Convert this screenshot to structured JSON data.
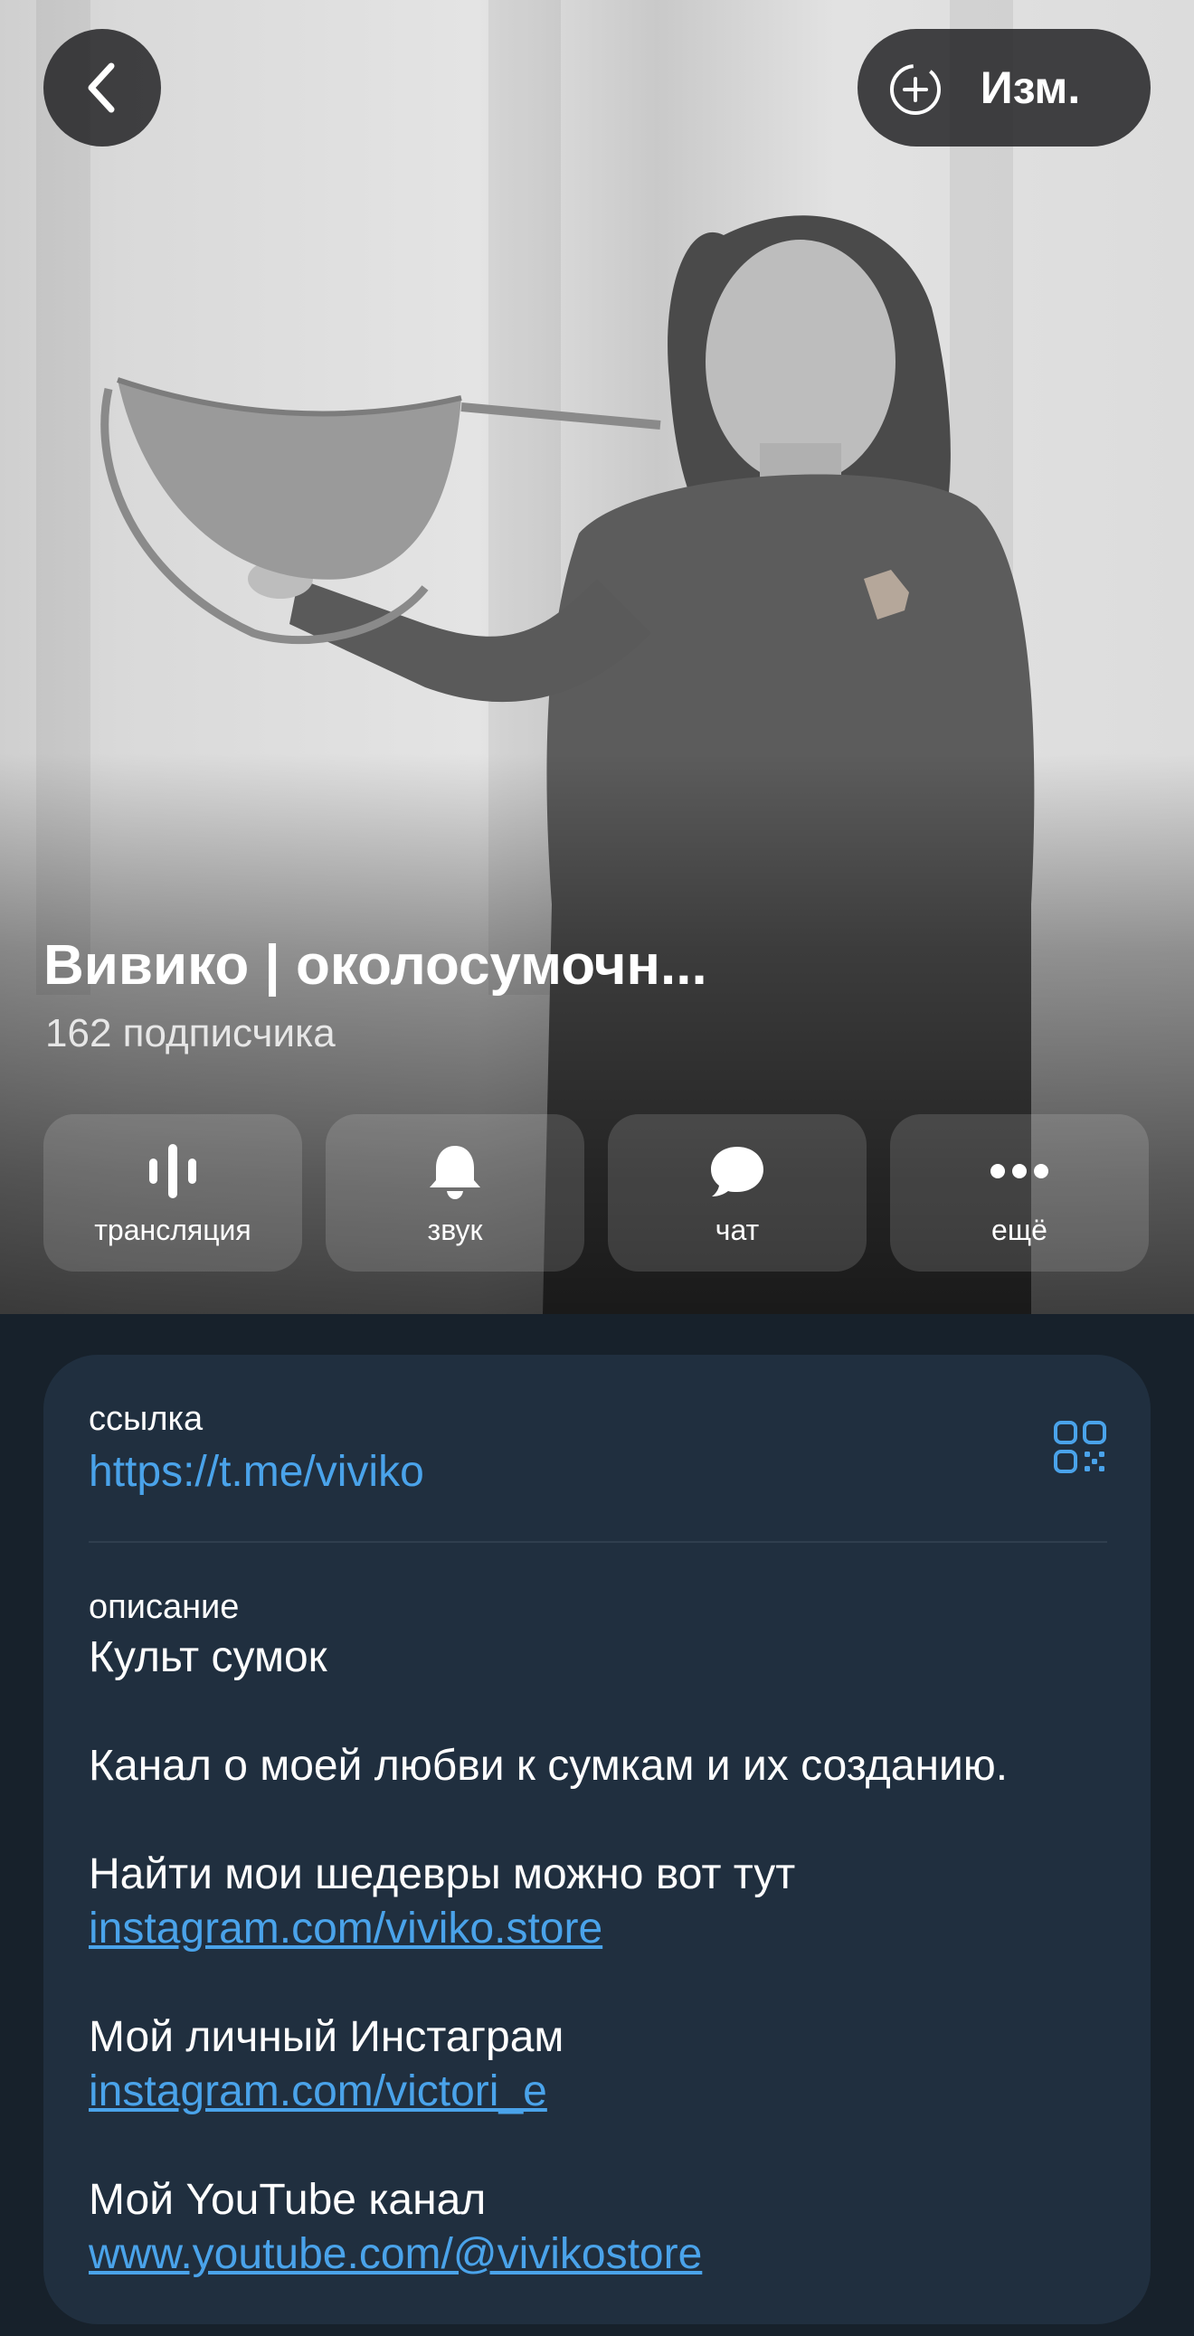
{
  "header": {
    "edit_label": "Изм.",
    "channel_title": "Вивико | околосумочн...",
    "subscribers": "162 подписчика"
  },
  "actions": [
    {
      "label": "трансляция",
      "icon": "voice-chat-icon"
    },
    {
      "label": "звук",
      "icon": "bell-icon"
    },
    {
      "label": "чат",
      "icon": "chat-bubble-icon"
    },
    {
      "label": "ещё",
      "icon": "more-dots-icon"
    }
  ],
  "info": {
    "link_label": "ссылка",
    "link_value": "https://t.me/viviko",
    "description_label": "описание",
    "description": {
      "line1": "Культ сумок",
      "line2": "Канал о моей любви к сумкам и их созданию.",
      "line3": "Найти мои шедевры можно вот тут",
      "link1": "instagram.com/viviko.store",
      "line4": "Мой личный Инстаграм",
      "link2": "instagram.com/victori_e",
      "line5": "Мой YouTube канал",
      "link3": "www.youtube.com/@vivikostore"
    }
  },
  "colors": {
    "background": "#17212b",
    "card": "#202f3f",
    "accent_link": "#4aa3ea"
  }
}
